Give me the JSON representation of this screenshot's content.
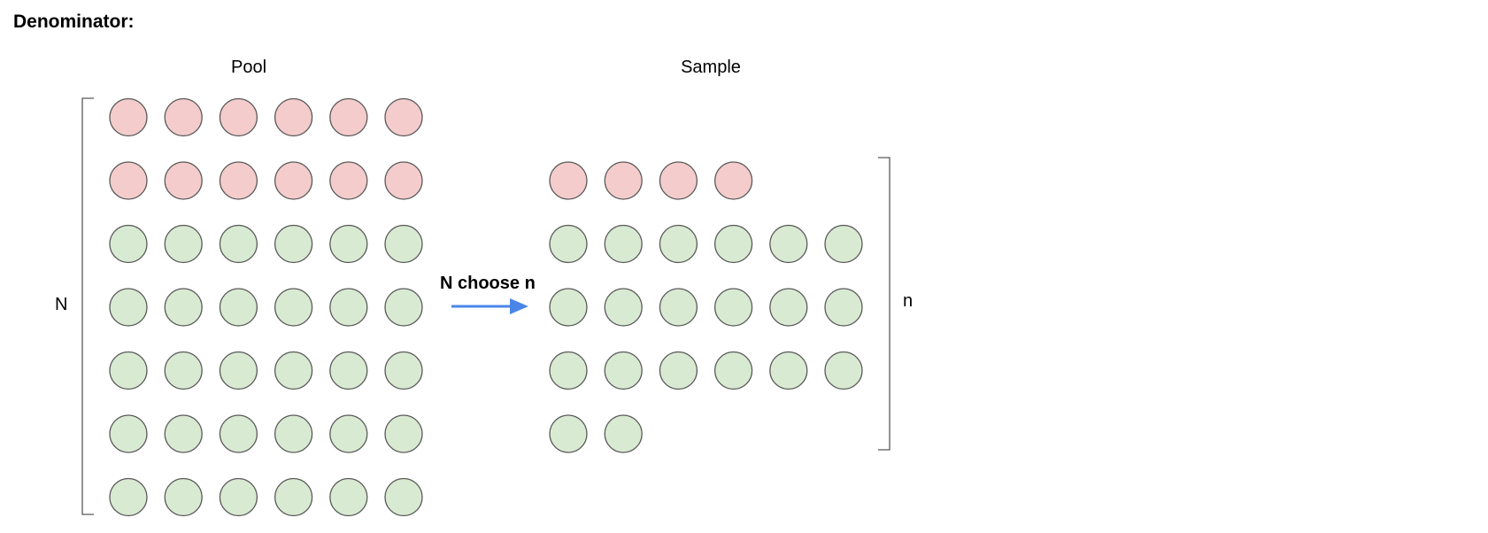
{
  "heading": "Denominator:",
  "pool": {
    "title": "Pool",
    "size_label": "N",
    "rows": [
      [
        "red",
        "red",
        "red",
        "red",
        "red",
        "red"
      ],
      [
        "red",
        "red",
        "red",
        "red",
        "red",
        "red"
      ],
      [
        "green",
        "green",
        "green",
        "green",
        "green",
        "green"
      ],
      [
        "green",
        "green",
        "green",
        "green",
        "green",
        "green"
      ],
      [
        "green",
        "green",
        "green",
        "green",
        "green",
        "green"
      ],
      [
        "green",
        "green",
        "green",
        "green",
        "green",
        "green"
      ],
      [
        "green",
        "green",
        "green",
        "green",
        "green",
        "green"
      ]
    ]
  },
  "sample": {
    "title": "Sample",
    "size_label": "n",
    "rows": [
      [],
      [
        "red",
        "red",
        "red",
        "red"
      ],
      [
        "green",
        "green",
        "green",
        "green",
        "green",
        "green"
      ],
      [
        "green",
        "green",
        "green",
        "green",
        "green",
        "green"
      ],
      [
        "green",
        "green",
        "green",
        "green",
        "green",
        "green"
      ],
      [
        "green",
        "green"
      ]
    ]
  },
  "operation": {
    "label": "N choose n",
    "arrow_icon": "arrow-right-icon"
  },
  "colors": {
    "red": "#f4cccc",
    "green": "#d9ead3",
    "stroke": "#595959",
    "arrow": "#4a86e8",
    "bracket": "#595959"
  }
}
